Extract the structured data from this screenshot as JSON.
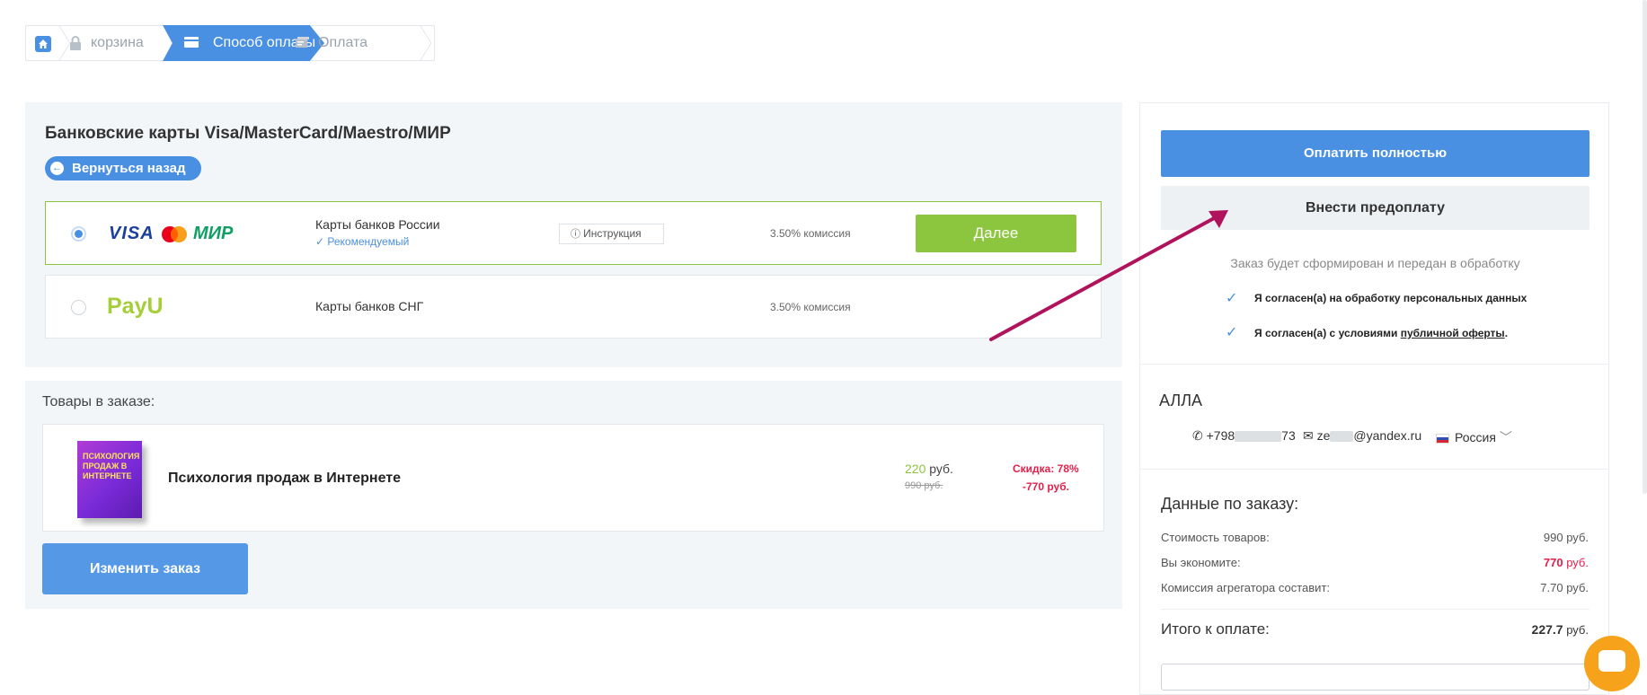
{
  "breadcrumb": {
    "home_icon": "home-icon",
    "cart": "корзина",
    "payment_method": "Способ оплаты",
    "payment": "Оплата"
  },
  "payment": {
    "title": "Банковские карты Visa/MasterCard/Maestro/МИР",
    "back_label": "Вернуться назад",
    "options": [
      {
        "logo": "VISA / MasterCard / МИР",
        "visa_text": "VISA",
        "mir_text": "МИР",
        "name": "Карты банков России",
        "recommended": "Рекомендуемый",
        "instruction": "Инструкция",
        "fee": "3.50% комиссия",
        "next_label": "Далее",
        "selected": true
      },
      {
        "logo_text": "PayU",
        "name": "Карты банков СНГ",
        "fee": "3.50% комиссия",
        "selected": false
      }
    ]
  },
  "goods": {
    "label": "Товары в заказе:",
    "item": {
      "cover_text": "ПСИХОЛОГИЯ ПРОДАЖ В ИНТЕРНЕТЕ",
      "name": "Психология продаж в Интернете",
      "price_new": "220",
      "currency": "руб.",
      "price_old": "990 руб.",
      "discount_label": "Скидка: 78%",
      "discount_amount": "-770 руб."
    },
    "change_label": "Изменить заказ"
  },
  "checkout": {
    "pay_full": "Оплатить полностью",
    "prepay": "Внести предоплату",
    "note": "Заказ будет сформирован и передан в обработку",
    "agree_personal": "Я согласен(а) на обработку персональных данных",
    "agree_offer_prefix": "Я согласен(а) с условиями ",
    "agree_offer_link": "публичной оферты",
    "agree_offer_suffix": "."
  },
  "customer": {
    "name": "АЛЛА",
    "phone_prefix": "+798",
    "phone_suffix": "73",
    "email_prefix": "ze",
    "email_suffix": "@yandex.ru",
    "country": "Россия"
  },
  "summary": {
    "title": "Данные по заказу:",
    "goods_cost_label": "Стоимость товаров:",
    "goods_cost_value": "990 руб.",
    "savings_label": "Вы экономите:",
    "savings_value": "770",
    "savings_currency": "руб.",
    "fee_label": "Комиссия агрегатора составит:",
    "fee_value": "7.70 руб.",
    "total_label": "Итого к оплате:",
    "total_value": "227.7",
    "total_currency": "руб."
  },
  "colors": {
    "accent": "#4a90e2",
    "success": "#8cc63f",
    "danger": "#e3204b",
    "arrow": "#b0135c"
  }
}
